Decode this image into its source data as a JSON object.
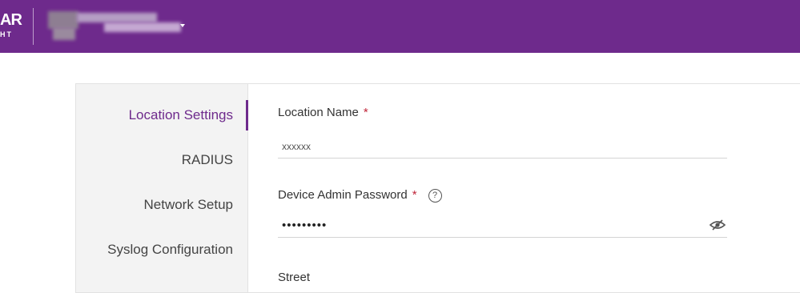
{
  "header": {
    "logo_text": "AR",
    "logo_subtext": "HT",
    "account_switch_icon": "chevron-down-icon"
  },
  "sidebar": {
    "items": [
      {
        "label": "Location Settings",
        "active": true
      },
      {
        "label": "RADIUS",
        "active": false
      },
      {
        "label": "Network Setup",
        "active": false
      },
      {
        "label": "Syslog Configuration",
        "active": false
      }
    ]
  },
  "form": {
    "location_name": {
      "label": "Location Name",
      "required_mark": "*",
      "value": "xxxxxx"
    },
    "admin_password": {
      "label": "Device Admin Password",
      "required_mark": "*",
      "help_icon": "?",
      "value": "•••••••••",
      "toggle_icon": "eye-slash-icon"
    },
    "street": {
      "label": "Street"
    }
  },
  "colors": {
    "brand": "#6e2a8c",
    "required": "#c0263a"
  }
}
